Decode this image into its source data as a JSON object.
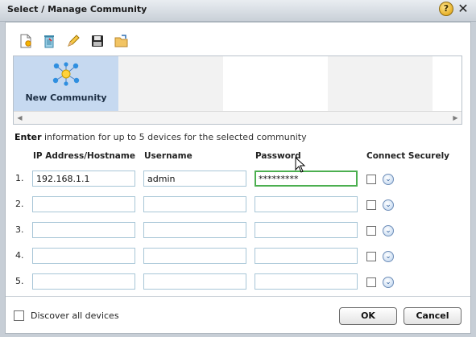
{
  "window": {
    "title": "Select / Manage Community",
    "help_glyph": "?",
    "close_glyph": "✕"
  },
  "toolbar": {
    "icons": [
      "new-icon",
      "delete-icon",
      "edit-icon",
      "save-icon",
      "open-folder-icon"
    ]
  },
  "communities": {
    "tiles": [
      {
        "label": "New Community",
        "icon": "community-network-icon",
        "selected": true
      }
    ],
    "scroll_left_glyph": "◀",
    "scroll_right_glyph": "▶"
  },
  "instructions": {
    "emphasis": "Enter",
    "rest": " information for up to 5 devices for the selected community"
  },
  "table": {
    "headers": {
      "ip": "IP Address/Hostname",
      "username": "Username",
      "password": "Password",
      "secure": "Connect Securely"
    },
    "rows": [
      {
        "num": "1.",
        "ip": "192.168.1.1",
        "username": "admin",
        "password": "*********",
        "secure": false
      },
      {
        "num": "2.",
        "ip": "",
        "username": "",
        "password": "",
        "secure": false
      },
      {
        "num": "3.",
        "ip": "",
        "username": "",
        "password": "",
        "secure": false
      },
      {
        "num": "4.",
        "ip": "",
        "username": "",
        "password": "",
        "secure": false
      },
      {
        "num": "5.",
        "ip": "",
        "username": "",
        "password": "",
        "secure": false
      }
    ],
    "dropdown_glyph": "⌄"
  },
  "footer": {
    "discover_label": "Discover all devices",
    "ok_label": "OK",
    "cancel_label": "Cancel"
  },
  "colors": {
    "selected_tile": "#c6d9f0",
    "focus_border": "#4caf50",
    "field_border": "#a8c6d7"
  }
}
